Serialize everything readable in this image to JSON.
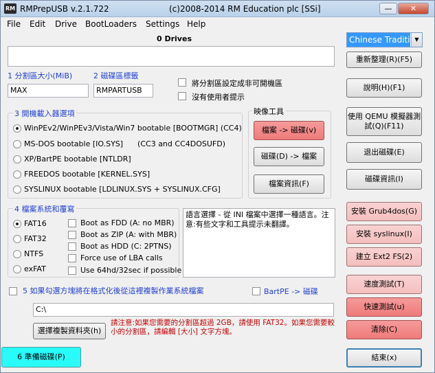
{
  "window": {
    "title": "RMPrepUSB v.2.1.722",
    "subtitle": "(c)2008-2014 RM Education plc [SSi]",
    "icon_text": "RM",
    "min_label": "—",
    "max_label": "☐",
    "close_label": "✕"
  },
  "menu": [
    "File",
    "Edit",
    "Drive",
    "BootLoaders",
    "Settings",
    "Help"
  ],
  "drives": {
    "header": "0 Drives",
    "list_value": ""
  },
  "language": {
    "selected": "Chinese Traditi"
  },
  "buttons": {
    "refresh": "重新整理(R)(F5)",
    "help": "說明(H)(F1)",
    "qemu": "使用 QEMU 模擬器測試(Q)(F11)",
    "eject": "退出磁碟(E)",
    "drive_info": "磁碟資訊(I)",
    "grub4dos": "安裝 Grub4dos(G)",
    "syslinux": "安裝 syslinux(I)",
    "ext2": "建立 Ext2 FS(2)",
    "speed_test": "速度測試(T)",
    "quick_test": "快速測試(u)",
    "clear": "清除(C)",
    "exit": "結束(x)",
    "prepare": "6 準備磁碟(P)",
    "select_folder": "選擇複製資料夾(h)",
    "img_to_drive": "檔案 -> 磁碟(v)",
    "drive_to_img": "磁碟(D) -> 檔案",
    "file_info": "檔案資訊(F)"
  },
  "partition": {
    "size_label": "1 分割區大小(MiB)",
    "size_value": "MAX",
    "volume_label": "2 磁碟區標籤",
    "volume_value": "RMPARTUSB",
    "non_bootable": "將分割區設定成非可開機區",
    "no_prompts": "沒有使用者提示"
  },
  "bootloader": {
    "title": "3 開機載入器選項",
    "options": [
      "WinPEv2/WinPEv3/Vista/Win7 bootable [BOOTMGR] (CC4)",
      "MS-DOS bootable [IO.SYS]      (CC3 and CC4DOSUFD)",
      "XP/BartPE bootable [NTLDR]",
      "FREEDOS bootable [KERNEL.SYS]",
      "SYSLINUX bootable [LDLINUX.SYS + SYSLINUX.CFG]"
    ],
    "selected_index": 0
  },
  "image_tools": {
    "title": "映像工具"
  },
  "filesystem": {
    "title": "4 檔案系統和覆寫",
    "options": [
      "FAT16",
      "FAT32",
      "NTFS",
      "exFAT"
    ],
    "selected_index": 0,
    "overrides": [
      "Boot as FDD (A: no MBR)",
      "Boot as ZIP (A: with MBR)",
      "Boot as HDD (C: 2PTNS)",
      "Force use of LBA calls",
      "Use 64hd/32sec if possible"
    ]
  },
  "info_text": "語言選擇 - 從 INI 檔案中選擇一種語言。注意:有些文字和工具提示未翻譯。",
  "copy": {
    "label": "5 如果勾選方塊將在格式化後從這裡複製作業系統檔案",
    "bartpe_label": "BartPE -> 磁碟",
    "path_value": "C:\\",
    "note": "請注意:如果您需要的分割區超過 2GB，請使用 FAT32。如果您需要較小的分割區，請編輯 [大小] 文字方塊。"
  }
}
